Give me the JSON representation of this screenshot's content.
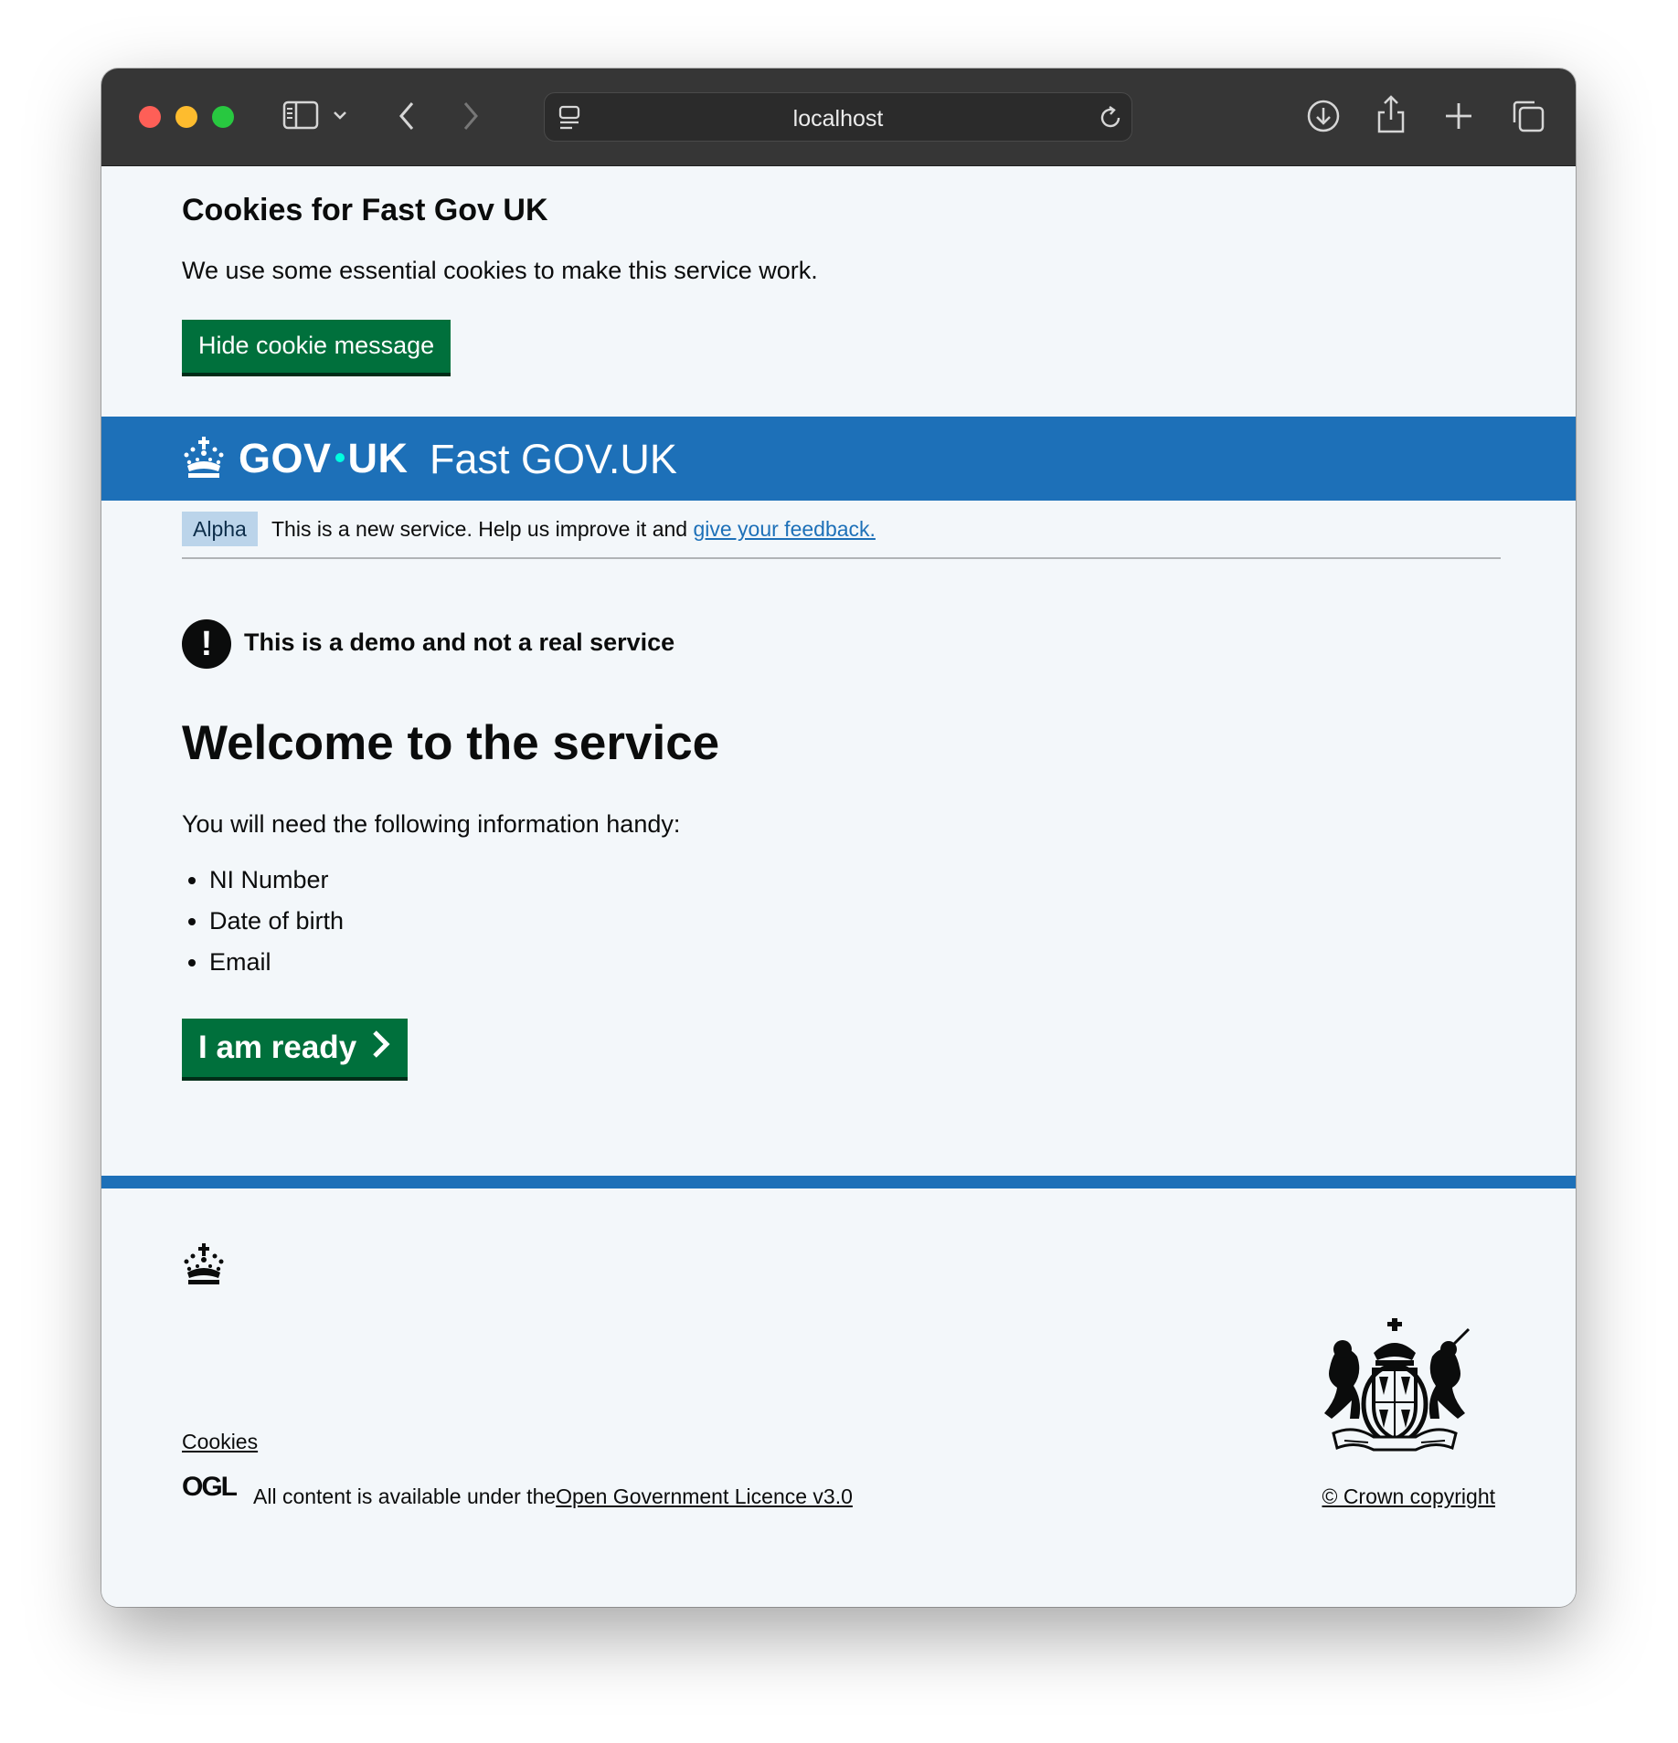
{
  "browser": {
    "url": "localhost",
    "icons": [
      "sidebar-icon",
      "chevron-down-icon",
      "back-icon",
      "forward-icon",
      "reader-icon",
      "reload-icon",
      "download-icon",
      "share-icon",
      "new-tab-icon",
      "tabs-overview-icon"
    ]
  },
  "cookie_banner": {
    "title": "Cookies for Fast Gov UK",
    "text": "We use some essential cookies to make this service work.",
    "hide_button": "Hide cookie message"
  },
  "header": {
    "gov_left": "GOV",
    "gov_right": "UK",
    "service_name": "Fast GOV.UK",
    "brand_color": "#1d70b8"
  },
  "phase_banner": {
    "tag": "Alpha",
    "text": "This is a new service. Help us improve it and ",
    "link": "give your feedback."
  },
  "main": {
    "warning": "This is a demo and not a real service",
    "heading": "Welcome to the service",
    "lead": "You will need the following information handy:",
    "items": [
      "NI Number",
      "Date of birth",
      "Email"
    ],
    "start_button": "I am ready",
    "button_color": "#00703c"
  },
  "footer": {
    "cookies_link": "Cookies",
    "ogl_logo": "OGL",
    "licence_text": "All content is available under the",
    "licence_link": "Open Government Licence v3.0",
    "copyright": "© Crown copyright"
  }
}
